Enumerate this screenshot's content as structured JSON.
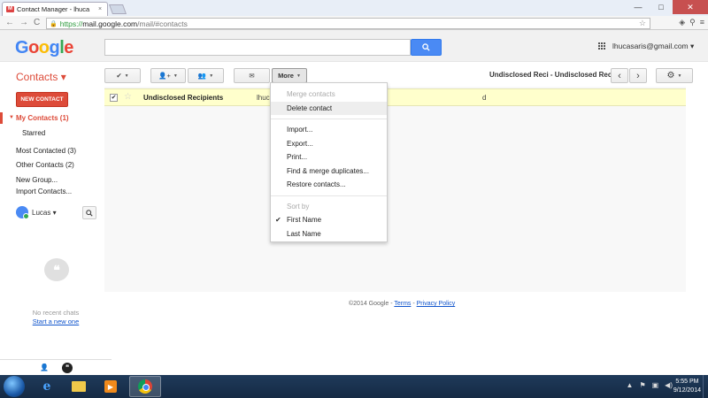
{
  "browser": {
    "tab_title": "Contact Manager - lhuca",
    "tab_close": "×",
    "url_https": "https://",
    "url_host": "mail.google.com",
    "url_path": "/mail/#contacts",
    "back": "←",
    "forward": "→",
    "reload": "C",
    "minimize": "—",
    "maximize": "□",
    "close": "✕"
  },
  "header": {
    "logo": [
      "G",
      "o",
      "o",
      "g",
      "l",
      "e"
    ],
    "search_placeholder": "",
    "account": "lhucasaris@gmail.com ▾"
  },
  "actionbar": {
    "title": "Contacts ▾",
    "more_label": "More",
    "paging_text": "Undisclosed Reci - Undisclosed Reci",
    "prev": "‹",
    "next": "›",
    "settings": "⚙"
  },
  "sidebar": {
    "new_contact": "NEW CONTACT",
    "my_contacts": "My Contacts (1)",
    "starred": "Starred",
    "most_contacted": "Most Contacted (3)",
    "other_contacts": "Other Contacts (2)",
    "new_group": "New Group...",
    "import_contacts": "Import Contacts...",
    "chat_user": "Lucas ▾",
    "no_recent_chats": "No recent chats",
    "start_new_one": "Start a new one"
  },
  "contact_row": {
    "name": "Undisclosed Recipients",
    "email": "lhuc",
    "extra": "d",
    "checked": true
  },
  "menu": {
    "items": [
      {
        "label": "Merge contacts",
        "disabled": true
      },
      {
        "label": "Delete contact",
        "hover": true
      },
      {
        "label": "Import..."
      },
      {
        "label": "Export..."
      },
      {
        "label": "Print..."
      },
      {
        "label": "Find & merge duplicates..."
      },
      {
        "label": "Restore contacts..."
      },
      {
        "label": "Sort by",
        "disabled": true
      },
      {
        "label": "First Name",
        "checked": true
      },
      {
        "label": "Last Name"
      }
    ]
  },
  "footer": {
    "copyright": "©2014 Google - ",
    "terms": "Terms",
    "sep": " - ",
    "privacy": "Privacy Policy"
  },
  "taskbar": {
    "time": "5:55 PM",
    "date": "9/12/2014"
  },
  "colors": {
    "accent_red": "#dd4b39",
    "search_blue": "#4a8af4",
    "row_highlight": "#ffffcc"
  }
}
